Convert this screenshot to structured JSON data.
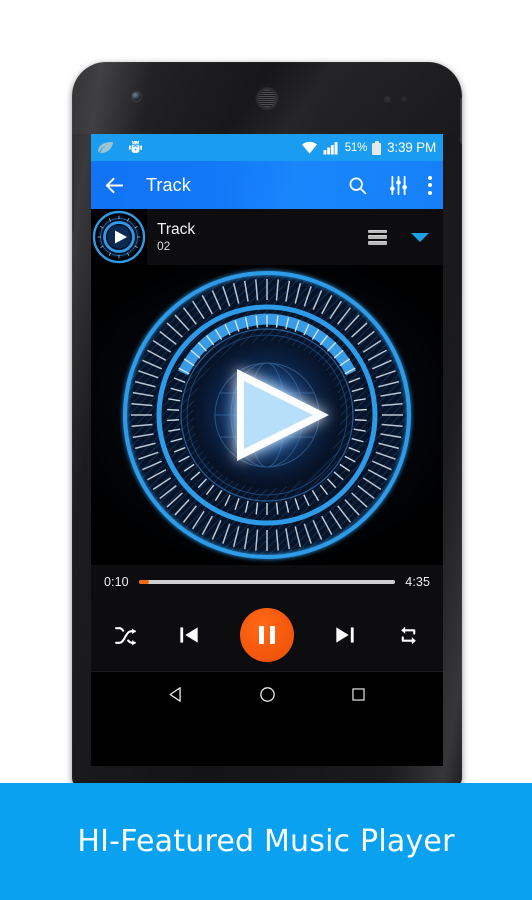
{
  "statusbar": {
    "icons_left": [
      "leaf-icon",
      "bug-icon"
    ],
    "wifi_icon": "wifi-icon",
    "signal_icon": "signal-bars-icon",
    "battery_percent": "51%",
    "battery_icon": "battery-icon",
    "time": "3:39 PM",
    "bg_color": "#1a9cf0"
  },
  "appbar": {
    "back_icon": "back-arrow-icon",
    "title": "Track",
    "search_icon": "search-icon",
    "equalizer_icon": "equalizer-icon",
    "overflow_icon": "more-vertical-icon",
    "bg_color": "#1279f7"
  },
  "now_playing": {
    "artwork_icon": "album-art-play-icon",
    "title": "Track",
    "subtitle": "02",
    "queue_icon": "list-lines-icon",
    "collapse_icon": "caret-down-icon",
    "caret_color": "#1e9fe8"
  },
  "artwork": {
    "icon": "hud-play-visualizer-icon",
    "ring_color": "#2e9be8",
    "glow_color": "#ffffff"
  },
  "seek": {
    "elapsed": "0:10",
    "duration": "4:35",
    "progress_percent": 4,
    "fill_color": "#f26b0f",
    "track_color": "#cfcfcf"
  },
  "controls": {
    "shuffle_icon": "shuffle-icon",
    "previous_icon": "skip-previous-icon",
    "play_pause_icon": "pause-icon",
    "play_pause_color": "#f4580c",
    "next_icon": "skip-next-icon",
    "repeat_icon": "repeat-icon"
  },
  "navbar": {
    "back_icon": "nav-back-triangle-icon",
    "home_icon": "nav-home-circle-icon",
    "recents_icon": "nav-recents-square-icon"
  },
  "banner": {
    "text": "HI-Featured Music Player",
    "bg_color": "#0aa2f0",
    "text_color": "#ffffff"
  }
}
